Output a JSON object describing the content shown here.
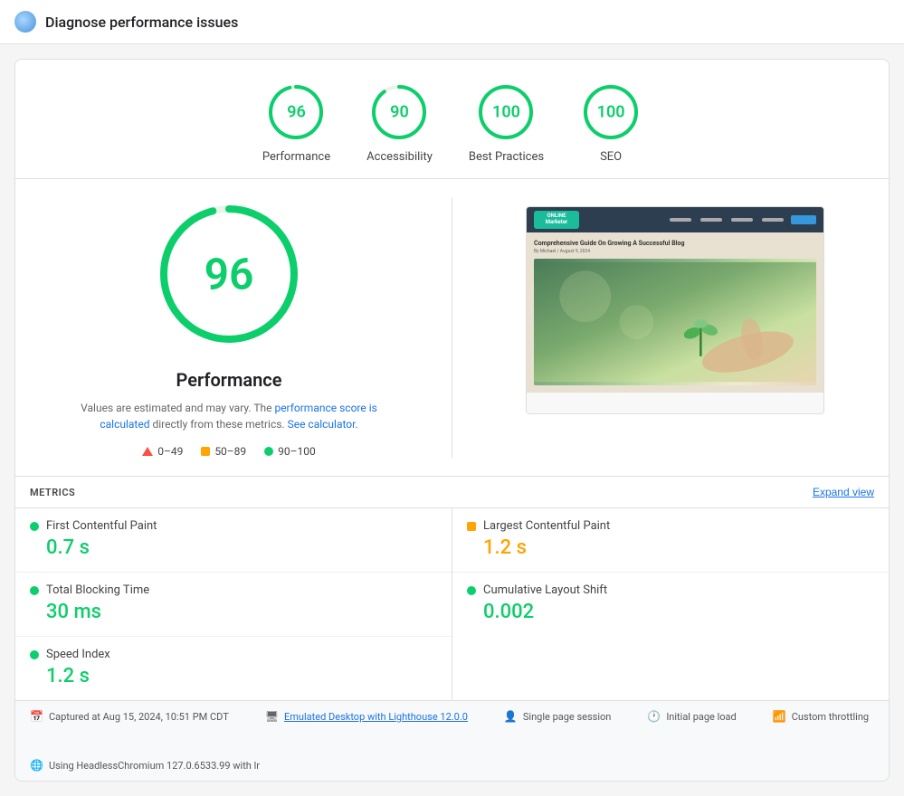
{
  "titleBar": {
    "title": "Diagnose performance issues",
    "iconAlt": "app-icon"
  },
  "scores": [
    {
      "id": "performance",
      "label": "Performance",
      "value": "96",
      "color": "#0cce6b",
      "radius": 28,
      "circumference": 175.9,
      "offset": 7
    },
    {
      "id": "accessibility",
      "label": "Accessibility",
      "value": "90",
      "color": "#0cce6b",
      "radius": 28,
      "circumference": 175.9,
      "offset": 17.6
    },
    {
      "id": "best-practices",
      "label": "Best Practices",
      "value": "100",
      "color": "#0cce6b",
      "radius": 28,
      "circumference": 175.9,
      "offset": 0
    },
    {
      "id": "seo",
      "label": "SEO",
      "value": "100",
      "color": "#0cce6b",
      "radius": 28,
      "circumference": 175.9,
      "offset": 0
    }
  ],
  "mainScore": {
    "value": "96",
    "title": "Performance",
    "desc1": "Values are estimated and may vary. The",
    "link1": "performance score is calculated",
    "desc2": "directly from these metrics.",
    "link2": "See calculator.",
    "radius": 72,
    "circumference": 452.4,
    "offset": 18.1
  },
  "legend": [
    {
      "type": "triangle",
      "range": "0–49"
    },
    {
      "type": "square",
      "range": "50–89"
    },
    {
      "type": "dot",
      "range": "90–100",
      "color": "#0cce6b"
    }
  ],
  "metrics": {
    "sectionTitle": "METRICS",
    "expandLabel": "Expand view",
    "items": [
      {
        "col": "left",
        "name": "First Contentful Paint",
        "value": "0.7 s",
        "valueClass": "green",
        "dotColor": "#0cce6b",
        "dotType": "circle"
      },
      {
        "col": "left",
        "name": "Total Blocking Time",
        "value": "30 ms",
        "valueClass": "green",
        "dotColor": "#0cce6b",
        "dotType": "circle"
      },
      {
        "col": "left",
        "name": "Speed Index",
        "value": "1.2 s",
        "valueClass": "green",
        "dotColor": "#0cce6b",
        "dotType": "circle"
      },
      {
        "col": "right",
        "name": "Largest Contentful Paint",
        "value": "1.2 s",
        "valueClass": "orange",
        "dotColor": "#ffa400",
        "dotType": "square"
      },
      {
        "col": "right",
        "name": "Cumulative Layout Shift",
        "value": "0.002",
        "valueClass": "green",
        "dotColor": "#0cce6b",
        "dotType": "circle"
      }
    ]
  },
  "footer": {
    "capturedAt": "Captured at Aug 15, 2024, 10:51 PM CDT",
    "device": "Emulated Desktop with Lighthouse 12.0.0",
    "session": "Single page session",
    "pageLoad": "Initial page load",
    "throttling": "Custom throttling",
    "browser": "Using HeadlessChromium 127.0.6533.99 with lr"
  }
}
